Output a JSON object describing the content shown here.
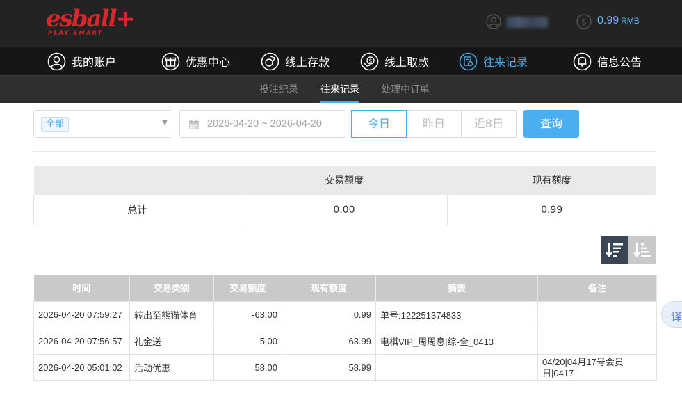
{
  "header": {
    "logo_text": "esball+",
    "logo_tagline": "PLAY SMART",
    "balance_value": "0.99",
    "balance_currency": "RMB",
    "accent_color": "#4aa9e8",
    "brand_color": "#d9262c"
  },
  "main_nav": {
    "items": [
      {
        "label": "我的账户",
        "icon": "user-icon"
      },
      {
        "label": "优惠中心",
        "icon": "gift-icon"
      },
      {
        "label": "线上存款",
        "icon": "deposit-icon"
      },
      {
        "label": "线上取款",
        "icon": "withdraw-icon"
      },
      {
        "label": "往来记录",
        "icon": "records-icon",
        "active": true
      },
      {
        "label": "信息公告",
        "icon": "bell-icon"
      }
    ]
  },
  "sub_nav": {
    "items": [
      {
        "label": "投注纪录"
      },
      {
        "label": "往来记录",
        "active": true
      },
      {
        "label": "处理中订单"
      }
    ]
  },
  "filters": {
    "type_selected": "全部",
    "date_range": "2026-04-20 ~ 2026-04-20",
    "quick_ranges": [
      "今日",
      "昨日",
      "近8日"
    ],
    "active_quick_range": "今日",
    "query_label": "查询"
  },
  "summary": {
    "headers": [
      "",
      "交易额度",
      "现有额度"
    ],
    "row": {
      "label": "总计",
      "transaction_amount": "0.00",
      "current_amount": "0.99"
    }
  },
  "sort": {
    "active": "descending",
    "icons": [
      "sort-descending-icon",
      "sort-ascending-icon"
    ]
  },
  "records": {
    "headers": [
      "时间",
      "交易类别",
      "交易额度",
      "现有额度",
      "摘要",
      "备注"
    ],
    "rows": [
      [
        "2026-04-20 07:59:27",
        "转出至熊猫体育",
        "-63.00",
        "0.99",
        "单号:122251374833",
        ""
      ],
      [
        "2026-04-20 07:56:57",
        "礼金送",
        "5.00",
        "63.99",
        "电棋VIP_周周息|综-全_0413",
        ""
      ],
      [
        "2026-04-20 05:01:02",
        "活动优惠",
        "58.00",
        "58.99",
        "",
        "04/20|04月17号会员日|0417"
      ]
    ]
  },
  "translate_widget": {
    "label": "译"
  }
}
